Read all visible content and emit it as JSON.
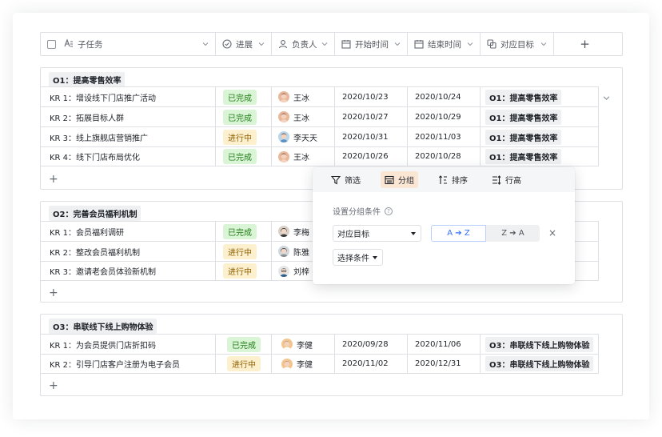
{
  "columns": {
    "task": "子任务",
    "progress": "进展",
    "owner": "负责人",
    "start": "开始时间",
    "end": "结束时间",
    "objective": "对应目标",
    "add": "+"
  },
  "groups": [
    {
      "title": "O1：提高零售效率",
      "rows": [
        {
          "task": "KR 1：增设线下门店推广活动",
          "status": "已完成",
          "status_kind": "done",
          "owner": "王冰",
          "start": "2020/10/23",
          "end": "2020/10/24",
          "objective": "O1：提高零售效率"
        },
        {
          "task": "KR 2：拓展目标人群",
          "status": "已完成",
          "status_kind": "done",
          "owner": "王冰",
          "start": "2020/10/27",
          "end": "2020/10/29",
          "objective": "O1：提高零售效率"
        },
        {
          "task": "KR 3：线上旗舰店营销推广",
          "status": "进行中",
          "status_kind": "prog",
          "owner": "李天天",
          "start": "2020/10/31",
          "end": "2020/11/03",
          "objective": "O1：提高零售效率"
        },
        {
          "task": "KR 4：线下门店布局优化",
          "status": "已完成",
          "status_kind": "done",
          "owner": "王冰",
          "start": "2020/10/26",
          "end": "2020/10/28",
          "objective": "O1：提高零售效率"
        }
      ]
    },
    {
      "title": "O2：完善会员福利机制",
      "rows": [
        {
          "task": "KR 1：会员福利调研",
          "status": "已完成",
          "status_kind": "done",
          "owner": "李梅",
          "start": "",
          "end": "",
          "objective": ""
        },
        {
          "task": "KR 2：整改会员福利机制",
          "status": "进行中",
          "status_kind": "prog",
          "owner": "陈雅",
          "start": "",
          "end": "",
          "objective": ""
        },
        {
          "task": "KR 3：邀请老会员体验新机制",
          "status": "进行中",
          "status_kind": "prog",
          "owner": "刘梓",
          "start": "",
          "end": "",
          "objective": ""
        }
      ]
    },
    {
      "title": "O3：串联线下线上购物体验",
      "rows": [
        {
          "task": "KR 1：为会员提供门店折扣码",
          "status": "已完成",
          "status_kind": "done",
          "owner": "李健",
          "start": "2020/09/28",
          "end": "2020/11/06",
          "objective": "O3：串联线下线上购物体验"
        },
        {
          "task": "KR 2：引导门店客户注册为电子会员",
          "status": "进行中",
          "status_kind": "prog",
          "owner": "李健",
          "start": "2020/11/02",
          "end": "2020/12/31",
          "objective": "O3：串联线下线上购物体验"
        }
      ]
    }
  ],
  "add_row_label": "+",
  "popover": {
    "tabs": [
      {
        "label": "筛选",
        "icon": "filter-icon"
      },
      {
        "label": "分组",
        "icon": "group-icon"
      },
      {
        "label": "排序",
        "icon": "sort-icon"
      },
      {
        "label": "行高",
        "icon": "row-height-icon"
      }
    ],
    "active_tab": "分组",
    "title": "设置分组条件",
    "help": "?",
    "field_select": "对应目标",
    "sort_asc": "A ➔ Z",
    "sort_desc": "Z ➔ A",
    "add_condition": "选择条件",
    "close": "×"
  },
  "colors": {
    "done_bg": "#d9f5d6",
    "done_text": "#237b19",
    "progress_bg": "#fdf0cf",
    "progress_text": "#8f5f00",
    "accent": "#3370ff",
    "active_tab_bg": "#fbe6d4"
  }
}
